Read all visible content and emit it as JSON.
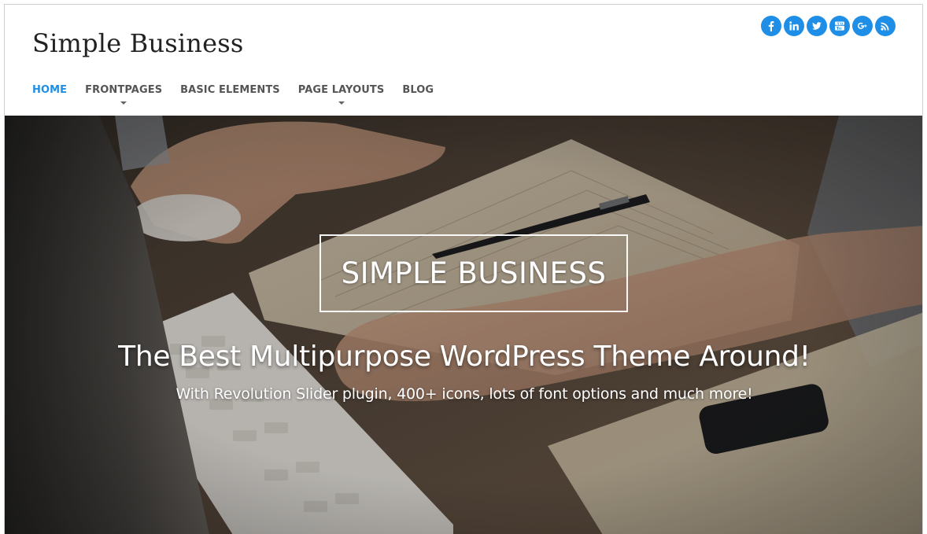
{
  "site": {
    "title": "Simple Business"
  },
  "social": [
    {
      "name": "facebook",
      "glyph": "f"
    },
    {
      "name": "linkedin",
      "glyph": "in"
    },
    {
      "name": "twitter",
      "glyph": ""
    },
    {
      "name": "youtube",
      "glyph": ""
    },
    {
      "name": "google-plus",
      "glyph": "g+"
    },
    {
      "name": "rss",
      "glyph": ""
    }
  ],
  "nav": {
    "items": [
      {
        "label": "HOME",
        "active": true,
        "dropdown": false
      },
      {
        "label": "FRONTPAGES",
        "active": false,
        "dropdown": true
      },
      {
        "label": "BASIC ELEMENTS",
        "active": false,
        "dropdown": false
      },
      {
        "label": "PAGE LAYOUTS",
        "active": false,
        "dropdown": true
      },
      {
        "label": "BLOG",
        "active": false,
        "dropdown": false
      }
    ]
  },
  "hero": {
    "box_title": "SIMPLE BUSINESS",
    "headline": "The Best Multipurpose WordPress Theme Around!",
    "subheadline": "With Revolution Slider plugin, 400+ icons, lots of font options and much more!"
  },
  "colors": {
    "accent": "#1e8ee6",
    "nav_text": "#555555",
    "title_text": "#222222"
  }
}
